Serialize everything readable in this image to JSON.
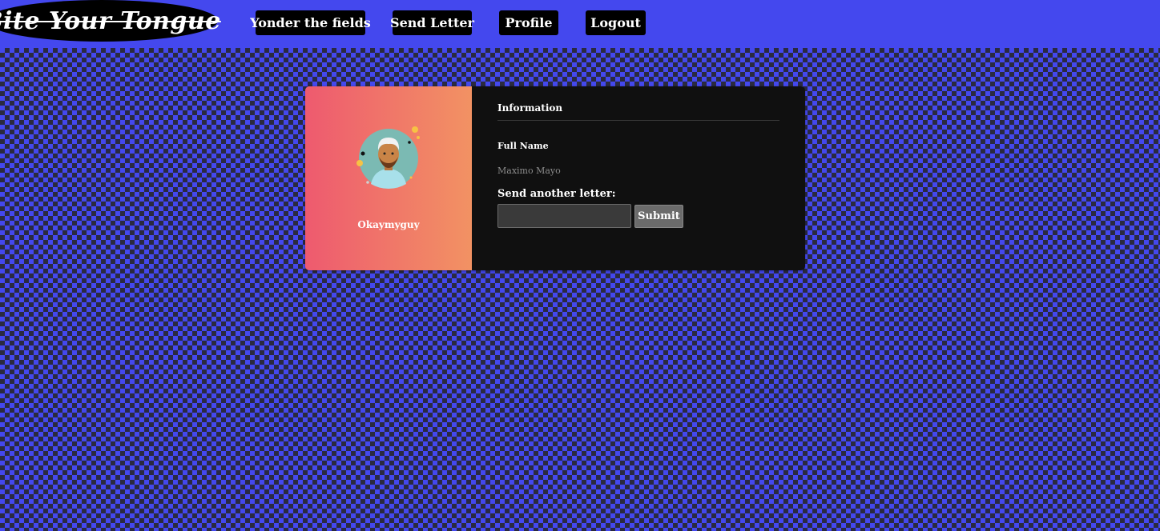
{
  "header": {
    "logo_text": "Bite Your Tongue",
    "nav": [
      {
        "label": "Yonder the fields"
      },
      {
        "label": "Send Letter"
      },
      {
        "label": "Profile"
      },
      {
        "label": "Logout"
      }
    ]
  },
  "profile": {
    "username": "Okaymyguy",
    "section_title": "Information",
    "full_name_label": "Full Name",
    "full_name_value": "Maximo Mayo",
    "letter_label": "Send another letter:",
    "letter_input_value": "",
    "submit_label": "Submit"
  },
  "colors": {
    "background_blue": "#4448ee",
    "checker_dark": "#2a2a40",
    "card_gradient_start": "#ee5a6f",
    "card_gradient_end": "#f29263",
    "card_dark": "#101010"
  },
  "icons": {
    "avatar": "user-avatar-illustration"
  }
}
